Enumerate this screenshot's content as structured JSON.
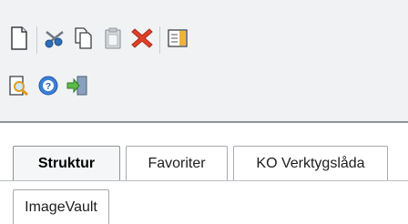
{
  "toolbar": {
    "row1": [
      "new-page-icon",
      "cut-icon",
      "copy-icon",
      "paste-icon",
      "delete-icon",
      "properties-icon"
    ],
    "row2": [
      "preview-icon",
      "help-icon",
      "exit-icon"
    ]
  },
  "tabs": [
    {
      "label": "Struktur",
      "active": true
    },
    {
      "label": "Favoriter",
      "active": false
    },
    {
      "label": "KO Verktygslåda",
      "active": false
    },
    {
      "label": "ImageVault",
      "active": false
    }
  ]
}
